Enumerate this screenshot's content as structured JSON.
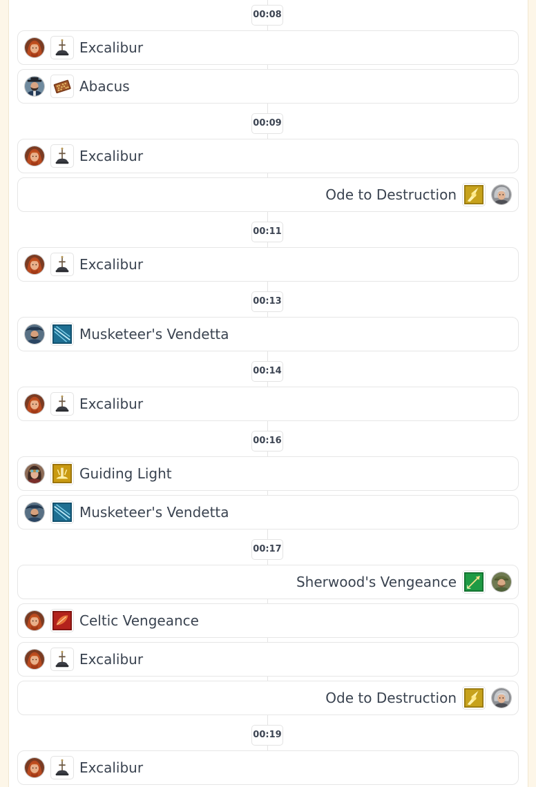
{
  "timeline": [
    {
      "type": "time",
      "text": "00:08"
    },
    {
      "type": "event",
      "side": "left",
      "skill": "Excalibur",
      "icon": "sword-in-stone-icon",
      "avatar": "red-haired-knight-avatar"
    },
    {
      "type": "event",
      "side": "left",
      "skill": "Abacus",
      "icon": "abacus-icon",
      "avatar": "bearded-man-hat-avatar"
    },
    {
      "type": "time",
      "text": "00:09"
    },
    {
      "type": "event",
      "side": "left",
      "skill": "Excalibur",
      "icon": "sword-in-stone-icon",
      "avatar": "red-haired-knight-avatar"
    },
    {
      "type": "event",
      "side": "right",
      "skill": "Ode to Destruction",
      "icon": "golden-burst-icon",
      "avatar": "grey-haired-composer-avatar"
    },
    {
      "type": "time",
      "text": "00:11"
    },
    {
      "type": "event",
      "side": "left",
      "skill": "Excalibur",
      "icon": "sword-in-stone-icon",
      "avatar": "red-haired-knight-avatar"
    },
    {
      "type": "time",
      "text": "00:13"
    },
    {
      "type": "event",
      "side": "left",
      "skill": "Musketeer's Vendetta",
      "icon": "blue-slash-icon",
      "avatar": "musketeer-avatar"
    },
    {
      "type": "time",
      "text": "00:14"
    },
    {
      "type": "event",
      "side": "left",
      "skill": "Excalibur",
      "icon": "sword-in-stone-icon",
      "avatar": "red-haired-knight-avatar"
    },
    {
      "type": "time",
      "text": "00:16"
    },
    {
      "type": "event",
      "side": "left",
      "skill": "Guiding Light",
      "icon": "golden-light-icon",
      "avatar": "goggles-woman-avatar"
    },
    {
      "type": "event",
      "side": "left",
      "skill": "Musketeer's Vendetta",
      "icon": "blue-slash-icon",
      "avatar": "musketeer-avatar"
    },
    {
      "type": "time",
      "text": "00:17"
    },
    {
      "type": "event",
      "side": "right",
      "skill": "Sherwood's Vengeance",
      "icon": "green-arrow-icon",
      "avatar": "archer-avatar"
    },
    {
      "type": "event",
      "side": "left",
      "skill": "Celtic Vengeance",
      "icon": "red-leaf-icon",
      "avatar": "red-haired-knight-avatar"
    },
    {
      "type": "event",
      "side": "left",
      "skill": "Excalibur",
      "icon": "sword-in-stone-icon",
      "avatar": "red-haired-knight-avatar"
    },
    {
      "type": "event",
      "side": "right",
      "skill": "Ode to Destruction",
      "icon": "golden-burst-icon",
      "avatar": "grey-haired-composer-avatar"
    },
    {
      "type": "time",
      "text": "00:19"
    },
    {
      "type": "event",
      "side": "left",
      "skill": "Excalibur",
      "icon": "sword-in-stone-icon",
      "avatar": "red-haired-knight-avatar"
    }
  ],
  "colors": {
    "page_background": "#fdf6e8",
    "card_background": "#ffffff",
    "text": "#3a4350",
    "border": "#e6e6e6"
  }
}
